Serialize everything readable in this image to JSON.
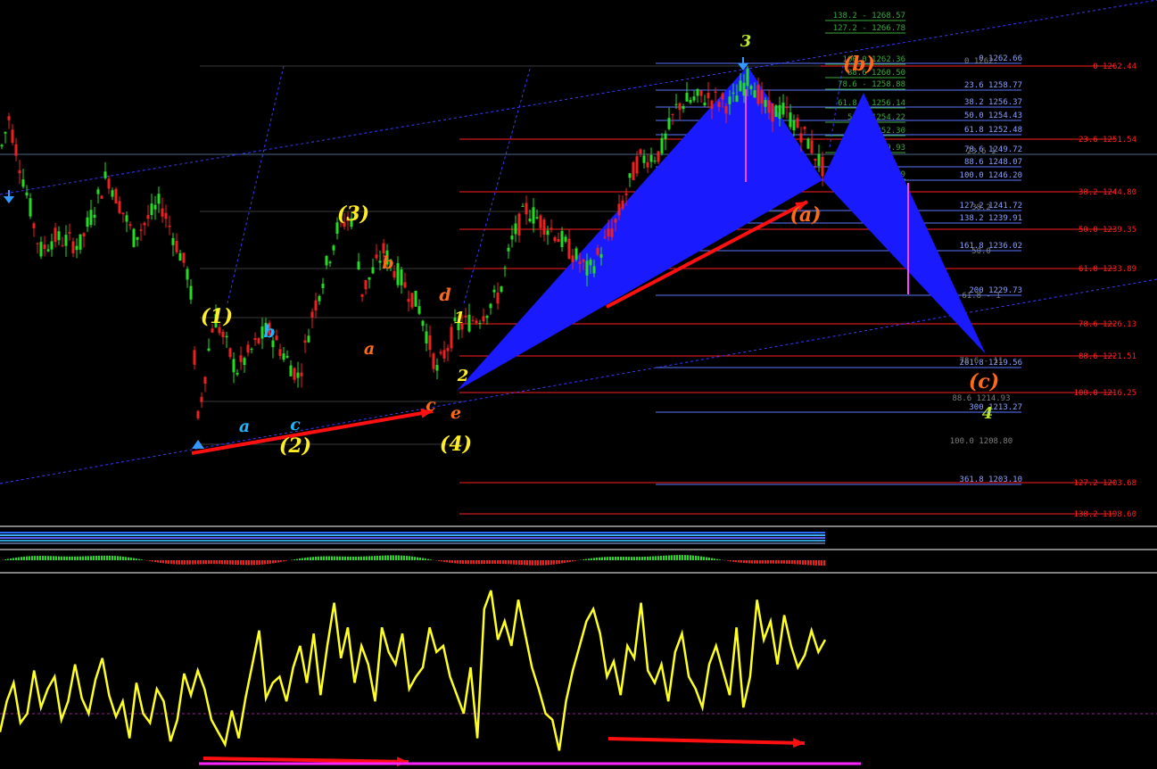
{
  "colors": {
    "background": "#000000",
    "bull_candle": "#22dd22",
    "bear_candle": "#ee2020",
    "fib_red": "#ff2020",
    "fib_green": "#3aaa3a",
    "fib_blue": "#5a78ff",
    "pattern_fill": "#1a1aff",
    "channel": "#3a3aff",
    "oscillator": "#ffff22",
    "divergence_arrow": "#ff1010",
    "divergence_base": "#ff22ff",
    "wave_yellow": "#ffee22",
    "wave_orange": "#ff6a1a",
    "wave_cyan": "#22b4ff",
    "wave_lime": "#b8e830",
    "marker_arrow": "#3399ff"
  },
  "chart_data": [
    {
      "type": "candlestick",
      "title": "",
      "xlabel": "",
      "ylabel": "",
      "ylim": [
        1196,
        1271
      ],
      "grid": false,
      "legend": "none",
      "pivots_price": [
        {
          "label": "start",
          "price": 1258.0
        },
        {
          "label": "(2) low",
          "price": 1209.5
        },
        {
          "label": "(3) high",
          "price": 1242.0
        },
        {
          "label": "(4) low",
          "price": 1217.5
        },
        {
          "label": "3 high",
          "price": 1262.4
        },
        {
          "label": "(a) low",
          "price": 1246.1
        }
      ],
      "wave_labels": [
        "(1)",
        "(2)",
        "(3)",
        "(4)",
        "a",
        "b",
        "c",
        "a",
        "b",
        "c",
        "d",
        "e",
        "1",
        "2",
        "3",
        "4",
        "(a)",
        "(b)",
        "(c)"
      ],
      "fib_levels_red": [
        {
          "label": "0 1262.44"
        },
        {
          "label": "23.6 1251.54"
        },
        {
          "label": "38.2 1244.80"
        },
        {
          "label": "50.0 1239.35"
        },
        {
          "label": "61.8 1233.89"
        },
        {
          "label": "78.6 1226.13"
        },
        {
          "label": "88.6 1221.51"
        },
        {
          "label": "100.0 1216.25"
        },
        {
          "label": "127.2 1203.68"
        },
        {
          "label": "138.2 1198.60"
        }
      ],
      "fib_levels_green": [
        {
          "label": "138.2 - 1268.57"
        },
        {
          "label": "127.2 - 1266.78"
        },
        {
          "label": "100.0 1262.36"
        },
        {
          "label": "88.6 1260.50"
        },
        {
          "label": "78.6 - 1258.88"
        },
        {
          "label": "61.8 - 1256.14"
        },
        {
          "label": "50.0 1254.22"
        },
        {
          "label": "38.2 1252.30"
        },
        {
          "label": "23.6 1249.93"
        },
        {
          "label": "0 1246.09"
        }
      ],
      "fib_levels_blue": [
        {
          "label": "0 1262.66"
        },
        {
          "label": "23.6 1258.77"
        },
        {
          "label": "38.2 1256.37"
        },
        {
          "label": "50.0 1254.43"
        },
        {
          "label": "61.8 1252.48"
        },
        {
          "label": "78.6 1249.72"
        },
        {
          "label": "88.6 1248.07"
        },
        {
          "label": "100.0 1246.20"
        },
        {
          "label": "127.2 1241.72"
        },
        {
          "label": "138.2 1239.91"
        },
        {
          "label": "161.8 1236.02"
        },
        {
          "label": "200 1229.73"
        },
        {
          "label": "261.8 1219.56"
        },
        {
          "label": "300 1213.27"
        },
        {
          "label": "361.8 1203.10"
        }
      ],
      "fib_levels_grey": [
        {
          "label": "0 1262."
        },
        {
          "label": "23.6 1"
        },
        {
          "label": "38.2"
        },
        {
          "label": "50.0"
        },
        {
          "label": "61.8 - 1"
        },
        {
          "label": "78.6 - 11"
        },
        {
          "label": "88.6 1214.93"
        },
        {
          "label": "100.0 1208.80"
        }
      ]
    },
    {
      "type": "line",
      "title": "",
      "series": [
        {
          "values": [
            52,
            62,
            68,
            55,
            58,
            72,
            60,
            66,
            70,
            56,
            62,
            74,
            63,
            58,
            69,
            76,
            64,
            57,
            62,
            50,
            68,
            58,
            55,
            66,
            62,
            49,
            56,
            71,
            64,
            72,
            66,
            56,
            52,
            48,
            59,
            50,
            63,
            74,
            85,
            63,
            68,
            70,
            62,
            73,
            80,
            68,
            84,
            64,
            80,
            94,
            76,
            86,
            68,
            80,
            74,
            62,
            86,
            78,
            74,
            84,
            66,
            70,
            73,
            86,
            78,
            80,
            70,
            64,
            58,
            73,
            50,
            92,
            98,
            82,
            88,
            80,
            95,
            84,
            73,
            66,
            58,
            56,
            46,
            62,
            72,
            80,
            88,
            92,
            84,
            70,
            75,
            64,
            80,
            76,
            94,
            72,
            68,
            74,
            62,
            78,
            84,
            70,
            66,
            60,
            74,
            80,
            72,
            64,
            86,
            60,
            70,
            95,
            82,
            88,
            74,
            90,
            80,
            73,
            77,
            85,
            78,
            82
          ]
        }
      ]
    }
  ]
}
